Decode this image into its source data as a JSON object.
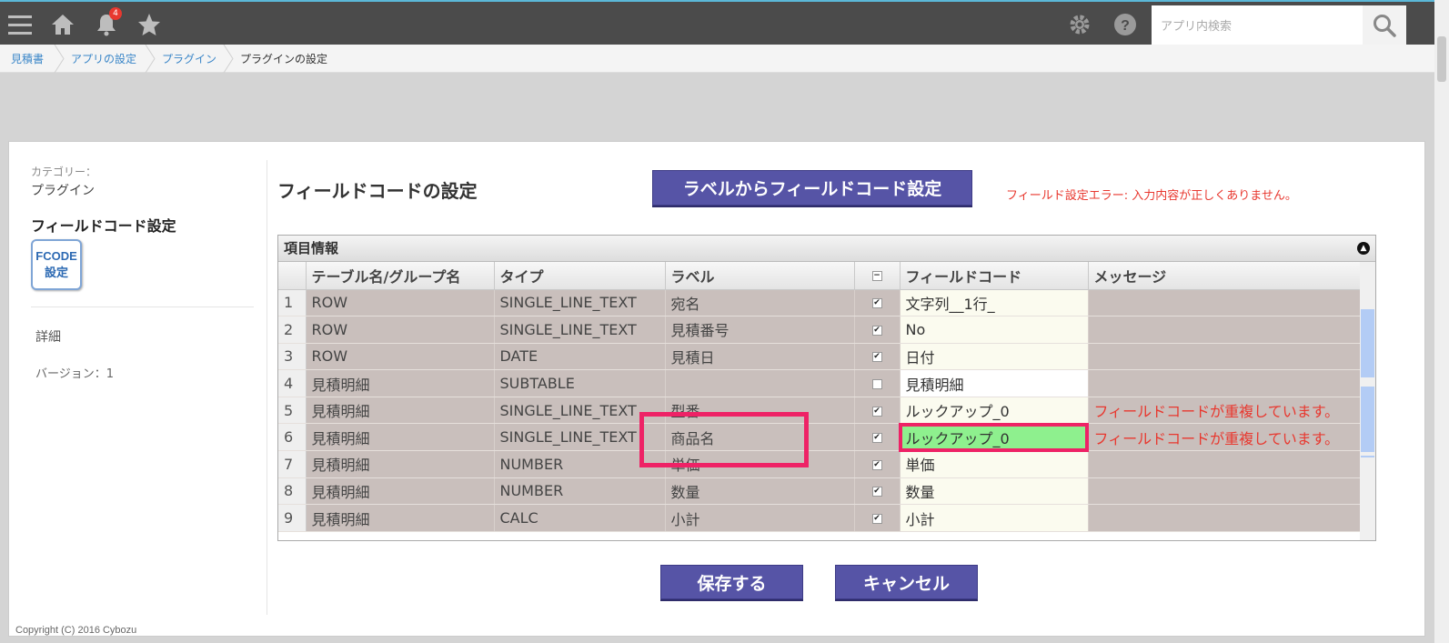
{
  "header": {
    "notification_count": "4",
    "search_placeholder": "アプリ内検索",
    "icons": [
      "menu-icon",
      "home-icon",
      "bell-icon",
      "star-icon",
      "gear-icon",
      "help-icon",
      "search-icon"
    ]
  },
  "breadcrumb": [
    "見積書",
    "アプリの設定",
    "プラグイン",
    "プラグインの設定"
  ],
  "sidebar": {
    "category_label": "カテゴリー：",
    "category_value": "プラグイン",
    "plugin_name": "フィールドコード設定",
    "logo_line1": "FCODE",
    "logo_line2": "設定",
    "detail_link": "詳細",
    "version": "バージョン：1"
  },
  "main": {
    "title": "フィールドコードの設定",
    "label_button": "ラベルからフィールドコード設定",
    "error_message": "フィールド設定エラー: 入力内容が正しくありません。",
    "save_button": "保存する",
    "cancel_button": "キャンセル"
  },
  "grid": {
    "caption": "項目情報",
    "columns": [
      "テーブル名/グループ名",
      "タイプ",
      "ラベル",
      "",
      "フィールドコード",
      "メッセージ"
    ],
    "rows": [
      {
        "no": "1",
        "table": "ROW",
        "type": "SINGLE_LINE_TEXT",
        "label": "宛名",
        "checked": true,
        "code": "文字列__1行_",
        "message": ""
      },
      {
        "no": "2",
        "table": "ROW",
        "type": "SINGLE_LINE_TEXT",
        "label": "見積番号",
        "checked": true,
        "code": "No",
        "message": ""
      },
      {
        "no": "3",
        "table": "ROW",
        "type": "DATE",
        "label": "見積日",
        "checked": true,
        "code": "日付",
        "message": ""
      },
      {
        "no": "4",
        "table": "見積明細",
        "type": "SUBTABLE",
        "label": "",
        "checked": false,
        "code": "見積明細",
        "message": ""
      },
      {
        "no": "5",
        "table": "見積明細",
        "type": "SINGLE_LINE_TEXT",
        "label": "型番",
        "checked": true,
        "code": "ルックアップ_0",
        "message": "フィールドコードが重複しています。"
      },
      {
        "no": "6",
        "table": "見積明細",
        "type": "SINGLE_LINE_TEXT",
        "label": "商品名",
        "checked": true,
        "code": "ルックアップ_0",
        "message": "フィールドコードが重複しています。"
      },
      {
        "no": "7",
        "table": "見積明細",
        "type": "NUMBER",
        "label": "単価",
        "checked": true,
        "code": "単価",
        "message": ""
      },
      {
        "no": "8",
        "table": "見積明細",
        "type": "NUMBER",
        "label": "数量",
        "checked": true,
        "code": "数量",
        "message": ""
      },
      {
        "no": "9",
        "table": "見積明細",
        "type": "CALC",
        "label": "小計",
        "checked": true,
        "code": "小計",
        "message": ""
      }
    ]
  },
  "footer": "Copyright (C) 2016 Cybozu"
}
